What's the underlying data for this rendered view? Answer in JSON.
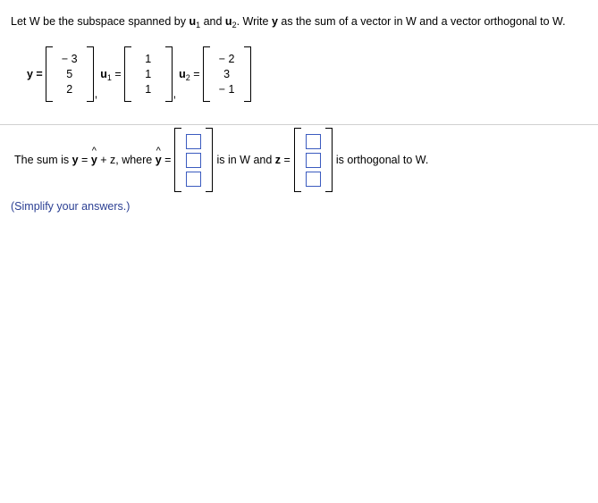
{
  "problem": {
    "statement_part1": "Let W be the subspace spanned by ",
    "u1_label": "u",
    "u1_sub": "1",
    "statement_and": " and ",
    "u2_label": "u",
    "u2_sub": "2",
    "statement_part2": ". Write ",
    "y_label": "y",
    "statement_part3": " as the sum of a vector in W and a vector orthogonal to W."
  },
  "vectors": {
    "y": {
      "label": "y =",
      "entries": [
        "− 3",
        "5",
        "2"
      ]
    },
    "u1": {
      "label_letter": "u",
      "label_sub": "1",
      "label_eq": "=",
      "entries": [
        "1",
        "1",
        "1"
      ]
    },
    "u2": {
      "label_letter": "u",
      "label_sub": "2",
      "label_eq": "=",
      "entries": [
        "− 2",
        "3",
        "− 1"
      ]
    },
    "separator": ","
  },
  "answer": {
    "lead_text": "The sum is ",
    "y_bold": "y",
    "equals": " = ",
    "yhat": "y",
    "plus_z": " + z, where ",
    "yhat2": "y",
    "eq2": " =",
    "middle_text": "is in W and ",
    "z_bold": "z",
    "eq3": " =",
    "tail_text": "is orthogonal to W.",
    "yhat_inputs": [
      "",
      "",
      ""
    ],
    "z_inputs": [
      "",
      "",
      ""
    ]
  },
  "footer": {
    "simplify_note": "(Simplify your answers.)"
  },
  "colors": {
    "input_border": "#3b5bbf",
    "note_text": "#2b3f93",
    "divider": "#d0d0d0"
  }
}
